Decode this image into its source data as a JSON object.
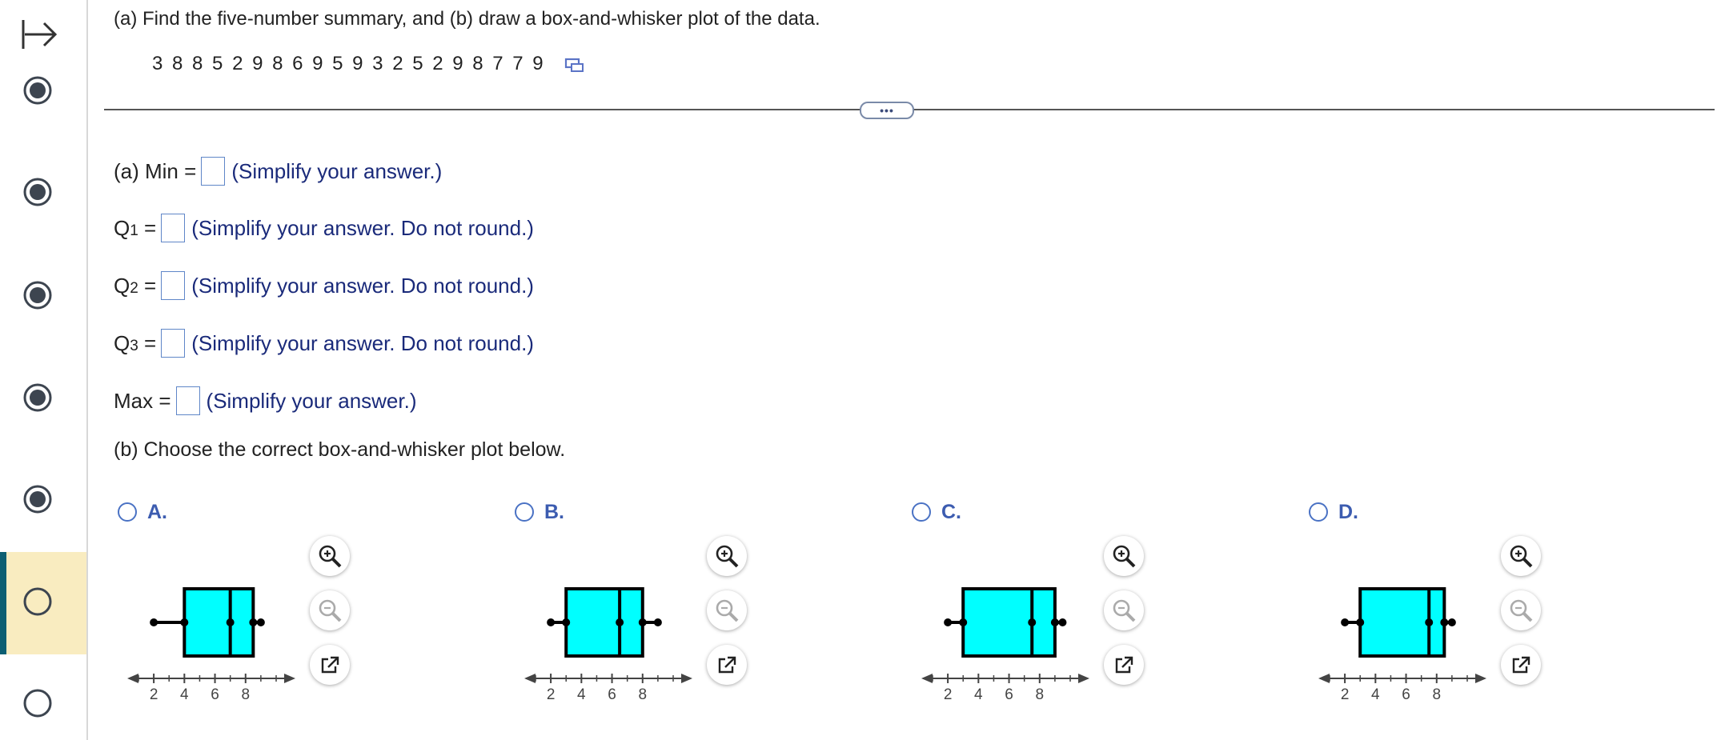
{
  "question": {
    "prompt": "(a) Find the five-number summary, and (b) draw a box-and-whisker plot of the data.",
    "data_values": "3 8 8 5 2 9 8 6 9 5 9 3 2 5 2 9 8 7 7 9"
  },
  "answers": {
    "min_label": "(a) Min =",
    "min_hint": "(Simplify your answer.)",
    "q1_label": "Q",
    "q1_sub": "1",
    "q1_hint": "(Simplify your answer. Do not round.)",
    "q2_label": "Q",
    "q2_sub": "2",
    "q2_hint": "(Simplify your answer. Do not round.)",
    "q3_label": "Q",
    "q3_sub": "3",
    "q3_hint": "(Simplify your answer. Do not round.)",
    "max_label": "Max =",
    "max_hint": "(Simplify your answer.)",
    "eq": "="
  },
  "part_b": "(b) Choose the correct box-and-whisker plot below.",
  "divider_handle": "•••",
  "options": [
    {
      "label": "A.",
      "min": 2,
      "q1": 4,
      "median": 7,
      "q3": 8.5,
      "max": 9
    },
    {
      "label": "B.",
      "min": 2,
      "q1": 3,
      "median": 6.5,
      "q3": 8,
      "max": 9
    },
    {
      "label": "C.",
      "min": 2,
      "q1": 3,
      "median": 7.5,
      "q3": 9,
      "max": 9.5
    },
    {
      "label": "D.",
      "min": 2,
      "q1": 3,
      "median": 7.5,
      "q3": 8.5,
      "max": 9
    }
  ],
  "axis": {
    "ticks": [
      "2",
      "4",
      "6",
      "8"
    ],
    "range": [
      1,
      10
    ]
  },
  "colors": {
    "box_fill": "#00ffff",
    "accent": "#3c5cb0",
    "hint": "#1a2a7a",
    "rail_active": "#0d5f73"
  },
  "icons": {
    "rail_top": "collapse-arrow-icon",
    "tools": [
      "zoom-in-icon",
      "zoom-out-icon",
      "open-in-new-window-icon"
    ]
  }
}
